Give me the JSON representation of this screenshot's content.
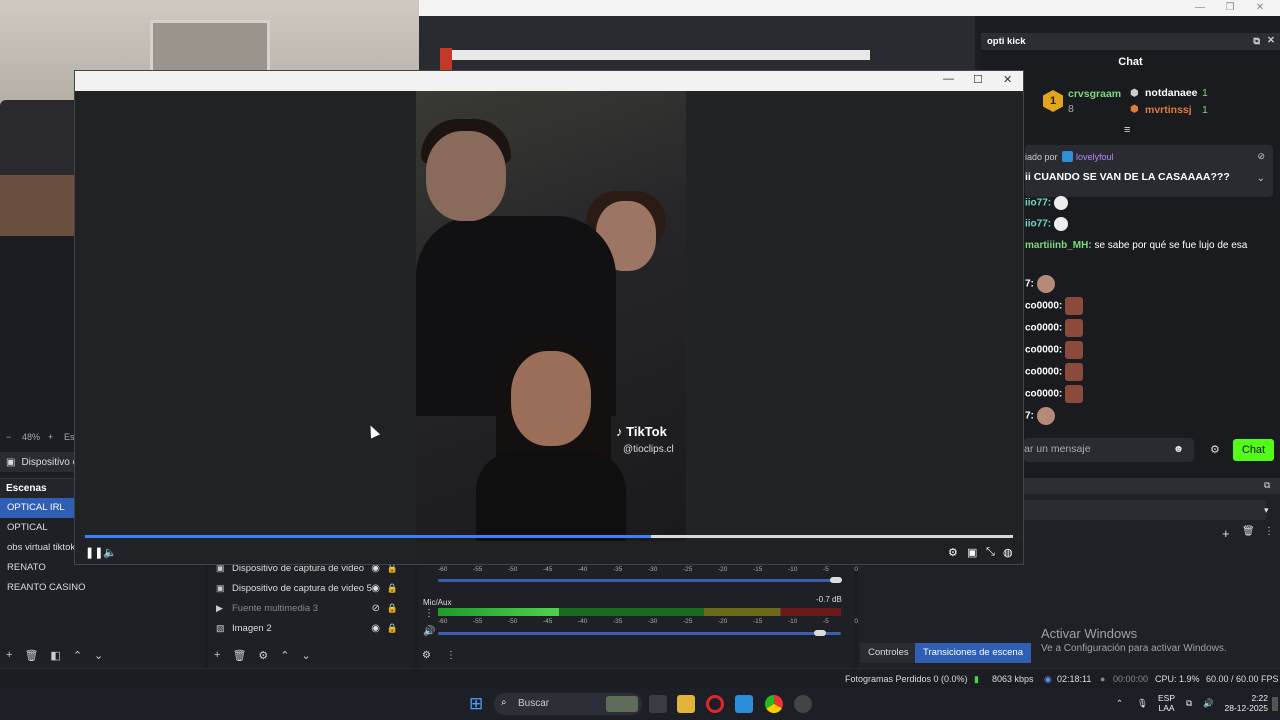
{
  "obs": {
    "zoom": "48%",
    "zoom_minus": "−",
    "zoom_plus": "+",
    "zoom_extra": "Esc",
    "source_toolbar_label": "Dispositivo c",
    "scenes_header": "Escenas",
    "scenes": [
      "OPTICAL IRL",
      "OPTICAL",
      "obs virtual tiktok",
      "RENATO",
      "REANTO CASINO"
    ],
    "sources": [
      {
        "name": "Dispositivo de captura de video",
        "icon": "camera-icon",
        "visible": true
      },
      {
        "name": "Dispositivo de captura de video 5",
        "icon": "camera-icon",
        "visible": true
      },
      {
        "name": "Fuente multimedia 3",
        "icon": "play-icon",
        "visible": false
      },
      {
        "name": "Imagen 2",
        "icon": "image-icon",
        "visible": true
      }
    ],
    "mixer": {
      "scale": [
        "-60",
        "-55",
        "-50",
        "-45",
        "-40",
        "-35",
        "-30",
        "-25",
        "-20",
        "-15",
        "-10",
        "-5",
        "0"
      ],
      "mic_label": "Mic/Aux",
      "mic_db": "-0.7 dB",
      "mic_level": 0.7
    },
    "tabs": {
      "controls": "Controles",
      "transitions": "Transiciones de escena"
    },
    "activate": {
      "title": "Activar Windows",
      "subtitle": "Ve a Configuración para activar Windows."
    },
    "status": {
      "dropped": "Fotogramas Perdidos 0 (0.0%)",
      "bitrate": "8063 kbps",
      "stream_time": "02:18:11",
      "rec_time": "00:00:00",
      "cpu": "CPU: 1.9%",
      "fps": "60.00 / 60.00 FPS"
    }
  },
  "chat": {
    "dock_title": "opti kick",
    "title": "Chat",
    "leaders": [
      {
        "rank": "1",
        "name": "crvsgraam",
        "count": "8"
      },
      {
        "name": "notdanaee",
        "count": "1"
      },
      {
        "name": "mvrtinssj",
        "count": "1"
      }
    ],
    "pinned_by_prefix": "iado por",
    "pinned_by_user": "lovelyfoul",
    "pinned_message": "ii CUANDO SE VAN DE LA CASAAAA???",
    "messages": [
      {
        "user": "iio77:",
        "text": ""
      },
      {
        "user": "iio77:",
        "text": ""
      },
      {
        "user": "martiiinb_MH:",
        "text": "se sabe por qué se fue lujo de esa"
      },
      {
        "user": "7:",
        "text": ""
      },
      {
        "user": "co0000:",
        "text": ""
      },
      {
        "user": "co0000:",
        "text": ""
      },
      {
        "user": "co0000:",
        "text": ""
      },
      {
        "user": "co0000:",
        "text": ""
      },
      {
        "user": "co0000:",
        "text": ""
      },
      {
        "user": "7:",
        "text": ""
      }
    ],
    "input_placeholder": "ar un mensaje",
    "send_label": "Chat"
  },
  "player": {
    "progress": 0.61,
    "watermark": "TikTok",
    "handle": "@tioclips.cl"
  },
  "taskbar": {
    "search_placeholder": "Buscar",
    "lang": "ESP",
    "lang_sub": "LAA",
    "time": "2:22",
    "date": "28-12-2025"
  },
  "colors": {
    "accent": "#2e5fb5",
    "kick_green": "#53fc18",
    "progress": "#3b82f6"
  }
}
